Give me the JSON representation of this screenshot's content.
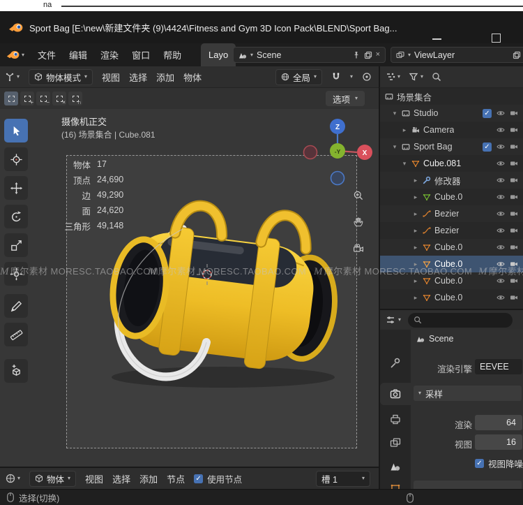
{
  "desktop": {
    "bg_text": "na"
  },
  "titlebar": {
    "title": "Sport Bag [E:\\new\\新建文件夹 (9)\\4424\\Fitness and Gym 3D Icon Pack\\BLEND\\Sport Bag..."
  },
  "topbar": {
    "menus": [
      "文件",
      "编辑",
      "渲染",
      "窗口",
      "帮助"
    ],
    "workspace_tab": "Layo",
    "scene_name": "Scene",
    "viewlayer_name": "ViewLayer"
  },
  "viewport_header": {
    "mode": "物体模式",
    "menus": [
      "视图",
      "选择",
      "添加",
      "物体"
    ],
    "orientation": "全局",
    "options": "选项"
  },
  "viewport": {
    "view_label": "摄像机正交",
    "context_label": "(16) 场景集合 | Cube.081",
    "stats": [
      {
        "label": "物体",
        "value": "17"
      },
      {
        "label": "顶点",
        "value": "24,690"
      },
      {
        "label": "边",
        "value": "49,290"
      },
      {
        "label": "面",
        "value": "24,620"
      },
      {
        "label": "三角形",
        "value": "49,148"
      }
    ],
    "gizmo": {
      "z": "Z",
      "x": "X",
      "y": "-Y"
    }
  },
  "outliner": {
    "title": "场景集合",
    "rows": [
      {
        "name": "Studio"
      },
      {
        "name": "Camera"
      },
      {
        "name": "Sport Bag"
      },
      {
        "name": "Cube.081"
      },
      {
        "name": "修改器"
      },
      {
        "name": "Cube.0"
      },
      {
        "name": "Bezier"
      },
      {
        "name": "Bezier"
      },
      {
        "name": "Cube.0"
      },
      {
        "name": "Cube.0"
      },
      {
        "name": "Cube.0"
      },
      {
        "name": "Cube.0"
      }
    ]
  },
  "properties": {
    "breadcrumb": "Scene",
    "engine_label": "渲染引擎",
    "engine_value": "EEVEE",
    "section_label": "采样",
    "render_label": "渲染",
    "render_value": "64",
    "viewport_label": "视图",
    "viewport_value": "16",
    "denoise_label": "视图降噪"
  },
  "shader_editor": {
    "type_label": "物体",
    "menus": [
      "视图",
      "选择",
      "添加",
      "节点"
    ],
    "use_nodes": "使用节点",
    "slot": "槽 1"
  },
  "statusbar": {
    "left": "选择(切换)"
  },
  "watermark": {
    "logo": "M",
    "text": "摩尔素材 MORESC.TAOBAO.COM"
  }
}
